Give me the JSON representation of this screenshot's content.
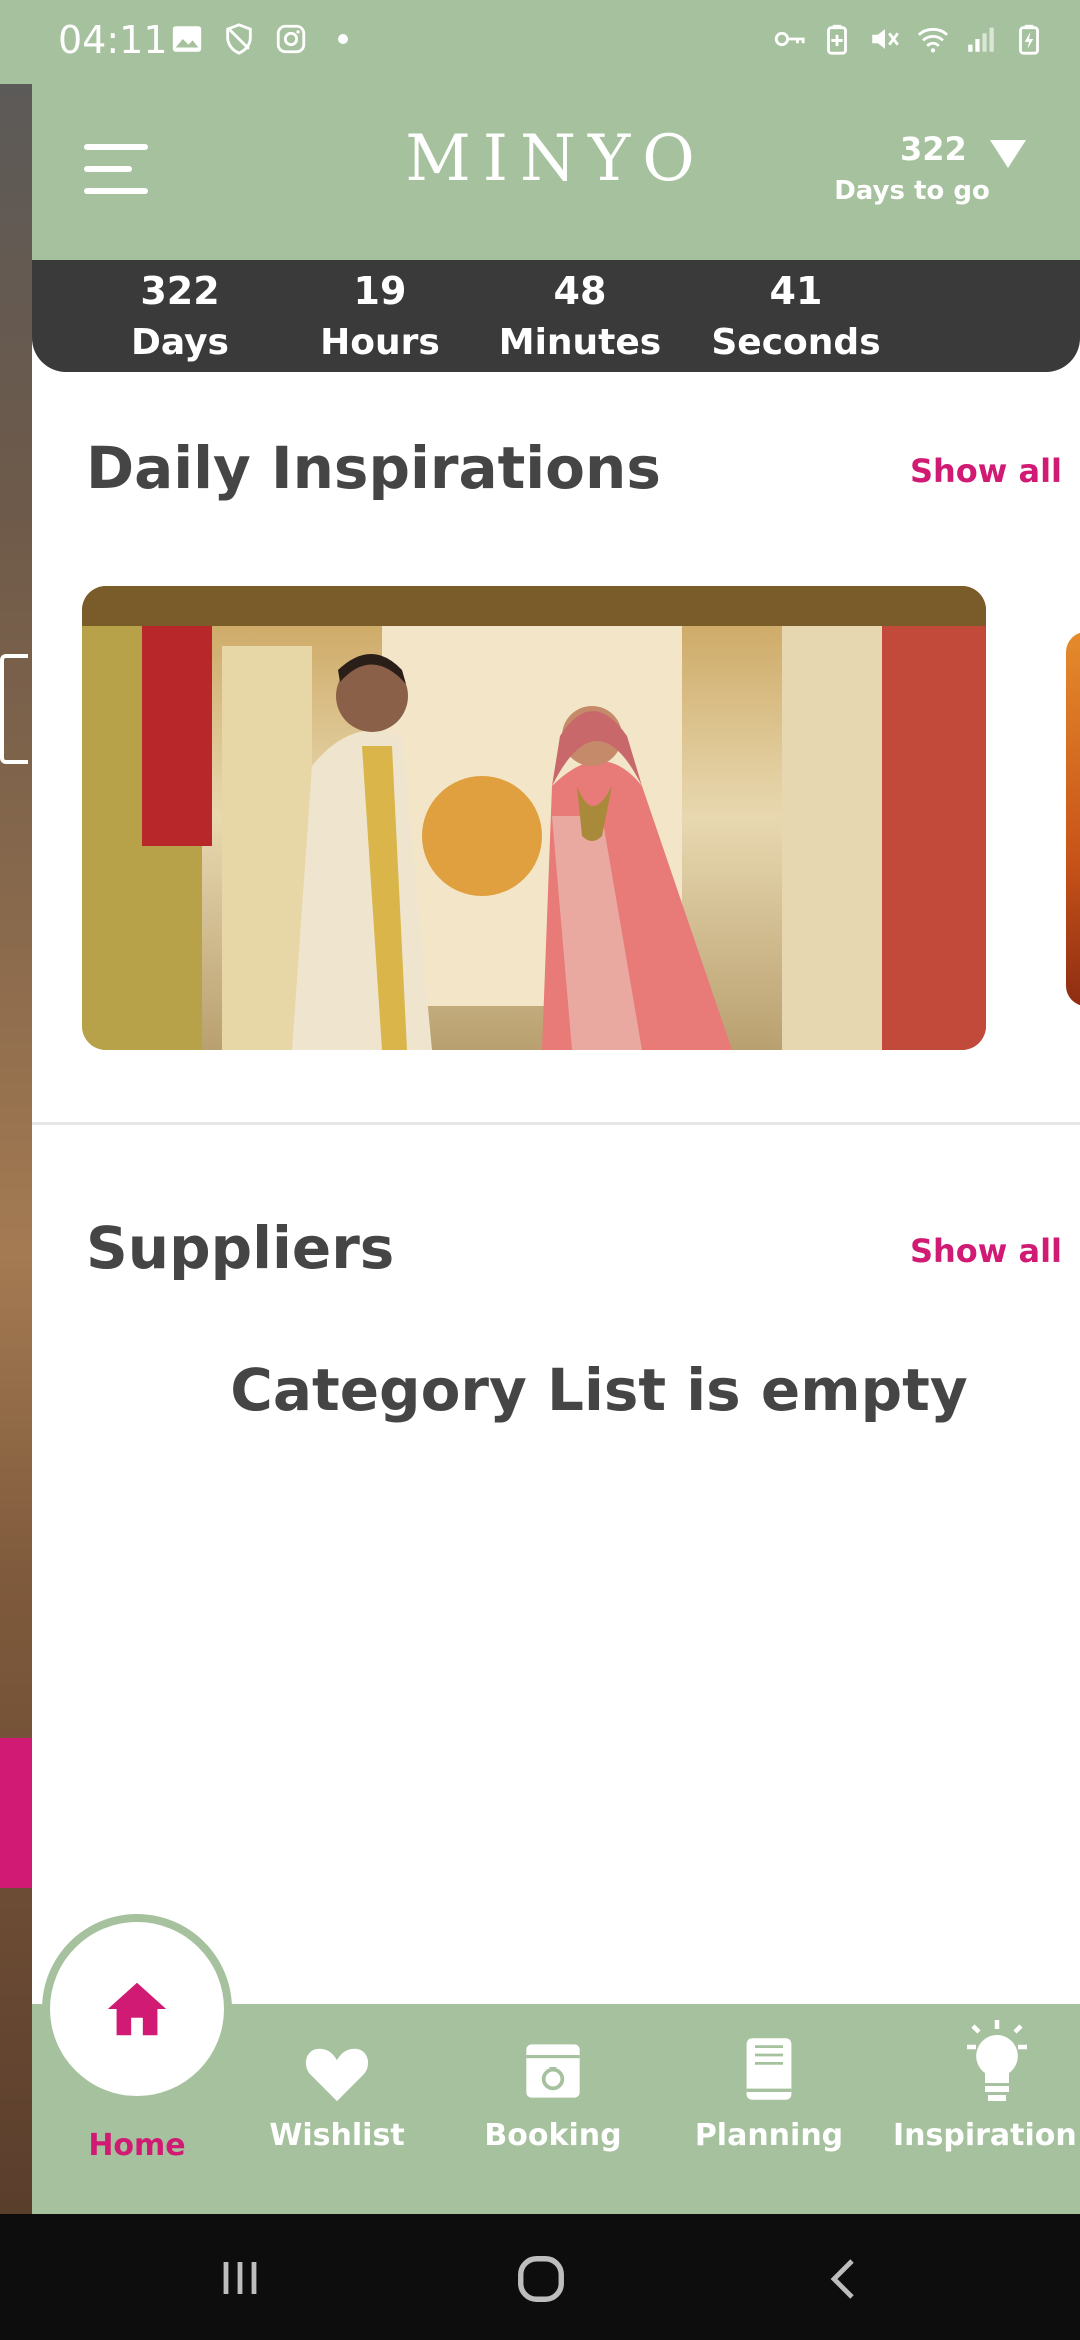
{
  "status_bar": {
    "time": "04:11",
    "left_icons": [
      "gallery-icon",
      "shield-icon",
      "instagram-icon",
      "dot-icon"
    ],
    "right_icons": [
      "vpn-key-icon",
      "battery-saver-icon",
      "mute-icon",
      "wifi-icon",
      "signal-icon",
      "battery-icon"
    ]
  },
  "header": {
    "logo": "MINYO",
    "days_count": "322",
    "days_label": "Days to go"
  },
  "countdown": [
    {
      "value": "322",
      "label": "Days"
    },
    {
      "value": "19",
      "label": "Hours"
    },
    {
      "value": "48",
      "label": "Minutes"
    },
    {
      "value": "41",
      "label": "Seconds"
    }
  ],
  "inspirations": {
    "title": "Daily Inspirations",
    "show_all": "Show all"
  },
  "suppliers": {
    "title": "Suppliers",
    "show_all": "Show all",
    "empty_message": "Category List is empty"
  },
  "bottom_nav": [
    {
      "label": "Home",
      "icon": "home-icon",
      "active": true
    },
    {
      "label": "Wishlist",
      "icon": "heart-icon",
      "active": false
    },
    {
      "label": "Booking",
      "icon": "booking-icon",
      "active": false
    },
    {
      "label": "Planning",
      "icon": "book-icon",
      "active": false
    },
    {
      "label": "Inspiration",
      "icon": "lightbulb-icon",
      "active": false
    }
  ],
  "colors": {
    "brand_green": "#a6c19d",
    "accent_pink": "#d11a73",
    "dark_bar": "#3a3a3a",
    "heading_text": "#454545"
  }
}
